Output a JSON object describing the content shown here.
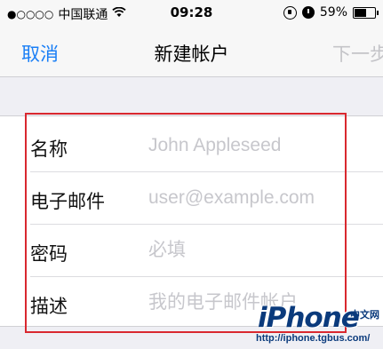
{
  "status_bar": {
    "signal": "●○○○○",
    "carrier": "中国联通",
    "wifi_icon": "wifi-icon",
    "time": "09:28",
    "rotation_lock_icon": "rotation-lock-icon",
    "alarm_icon": "alarm-icon",
    "battery_percent": "59%",
    "battery_level": 0.59
  },
  "nav": {
    "cancel_label": "取消",
    "title": "新建帐户",
    "next_label": "下一步"
  },
  "form": {
    "fields": [
      {
        "label": "名称",
        "value": "",
        "placeholder": "John Appleseed"
      },
      {
        "label": "电子邮件",
        "value": "",
        "placeholder": "user@example.com"
      },
      {
        "label": "密码",
        "value": "",
        "placeholder": "必填"
      },
      {
        "label": "描述",
        "value": "",
        "placeholder": "我的电子邮件帐户"
      }
    ]
  },
  "colors": {
    "accent": "#1a7ff6",
    "disabled": "#c4c4c8",
    "highlight_border": "#d9282f",
    "placeholder": "#c7c7cc"
  },
  "watermark": {
    "logo": "iPhone",
    "site_cn": "中文网",
    "url": "http://iphone.tgbus.com/"
  }
}
